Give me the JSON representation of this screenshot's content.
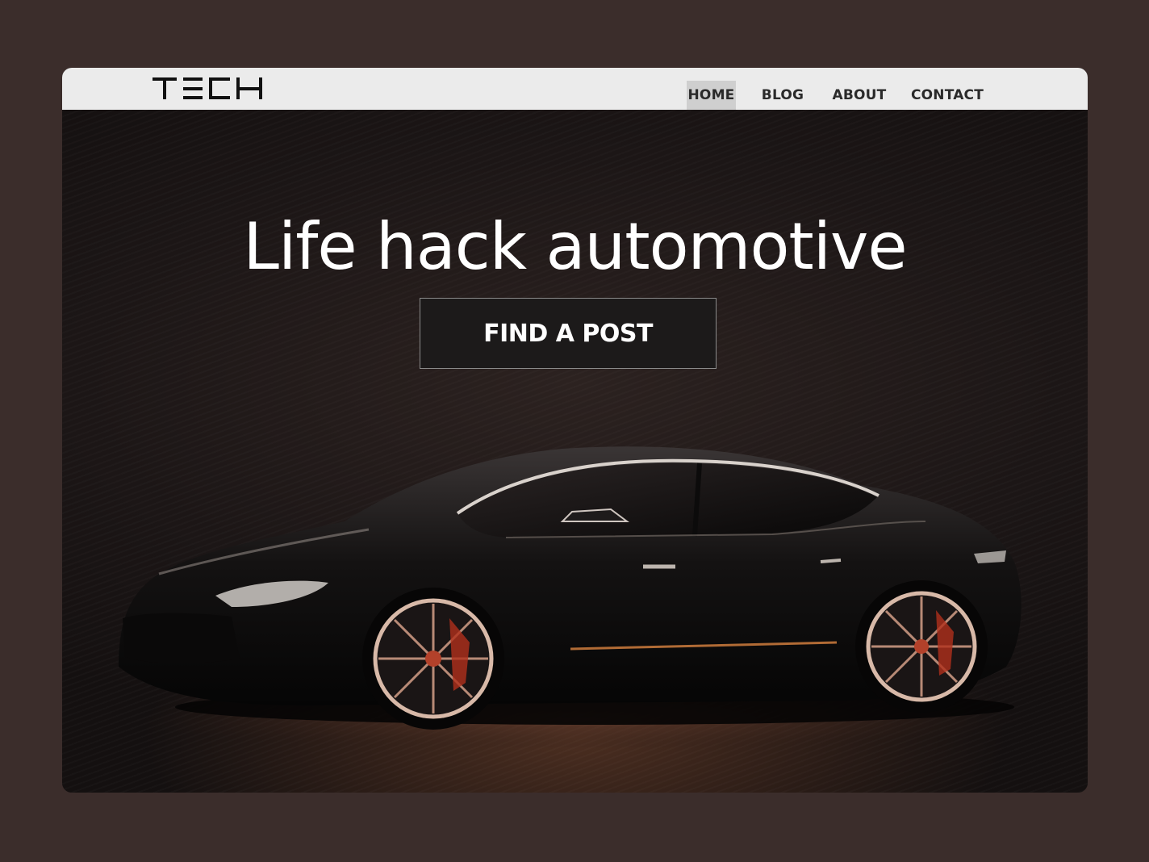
{
  "brand": {
    "logo_text": "TECH"
  },
  "nav": {
    "items": [
      {
        "label": "HOME",
        "active": true
      },
      {
        "label": "BLOG",
        "active": false
      },
      {
        "label": "ABOUT",
        "active": false
      },
      {
        "label": "CONTACT",
        "active": false
      }
    ]
  },
  "hero": {
    "headline": "Life hack automotive",
    "cta_label": "FIND A POST",
    "image": "black-sports-sedan"
  },
  "colors": {
    "page_background": "#3b2d2b",
    "navbar_background": "#ebebeb",
    "active_nav_background": "#cfcfcf",
    "hero_background": "#1c1616",
    "text_light": "#ffffff"
  }
}
